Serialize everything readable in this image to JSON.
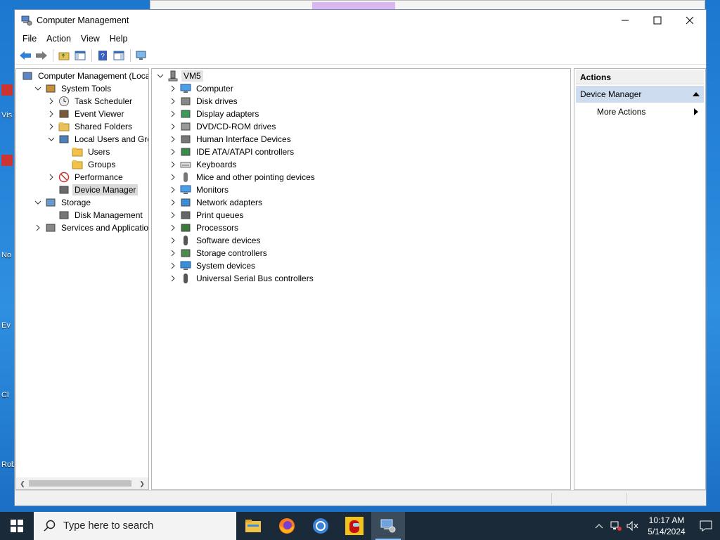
{
  "window": {
    "title": "Computer Management"
  },
  "menu": [
    "File",
    "Action",
    "View",
    "Help"
  ],
  "left_tree": [
    {
      "label": "Computer Management (Local",
      "level": 0,
      "expander": "none",
      "icon": "computer-management-icon"
    },
    {
      "label": "System Tools",
      "level": 1,
      "expander": "open",
      "icon": "system-tools-icon"
    },
    {
      "label": "Task Scheduler",
      "level": 2,
      "expander": "closed",
      "icon": "clock-icon"
    },
    {
      "label": "Event Viewer",
      "level": 2,
      "expander": "closed",
      "icon": "event-viewer-icon"
    },
    {
      "label": "Shared Folders",
      "level": 2,
      "expander": "closed",
      "icon": "shared-folder-icon"
    },
    {
      "label": "Local Users and Groups",
      "level": 2,
      "expander": "open",
      "icon": "users-icon"
    },
    {
      "label": "Users",
      "level": 3,
      "expander": "none",
      "icon": "folder-icon"
    },
    {
      "label": "Groups",
      "level": 3,
      "expander": "none",
      "icon": "folder-icon"
    },
    {
      "label": "Performance",
      "level": 2,
      "expander": "closed",
      "icon": "performance-icon"
    },
    {
      "label": "Device Manager",
      "level": 2,
      "expander": "none",
      "icon": "device-manager-icon",
      "selected": true
    },
    {
      "label": "Storage",
      "level": 1,
      "expander": "open",
      "icon": "storage-icon"
    },
    {
      "label": "Disk Management",
      "level": 2,
      "expander": "none",
      "icon": "disk-management-icon"
    },
    {
      "label": "Services and Applications",
      "level": 1,
      "expander": "closed",
      "icon": "services-icon"
    }
  ],
  "device_tree": {
    "root": "VM5",
    "items": [
      {
        "label": "Computer",
        "icon": "monitor-icon"
      },
      {
        "label": "Disk drives",
        "icon": "disk-drive-icon"
      },
      {
        "label": "Display adapters",
        "icon": "display-adapter-icon"
      },
      {
        "label": "DVD/CD-ROM drives",
        "icon": "dvd-icon"
      },
      {
        "label": "Human Interface Devices",
        "icon": "hid-icon"
      },
      {
        "label": "IDE ATA/ATAPI controllers",
        "icon": "ide-controller-icon"
      },
      {
        "label": "Keyboards",
        "icon": "keyboard-icon"
      },
      {
        "label": "Mice and other pointing devices",
        "icon": "mouse-icon"
      },
      {
        "label": "Monitors",
        "icon": "monitor-icon"
      },
      {
        "label": "Network adapters",
        "icon": "network-adapter-icon"
      },
      {
        "label": "Print queues",
        "icon": "printer-icon"
      },
      {
        "label": "Processors",
        "icon": "processor-icon"
      },
      {
        "label": "Software devices",
        "icon": "software-device-icon"
      },
      {
        "label": "Storage controllers",
        "icon": "storage-controller-icon"
      },
      {
        "label": "System devices",
        "icon": "system-device-icon"
      },
      {
        "label": "Universal Serial Bus controllers",
        "icon": "usb-icon"
      }
    ]
  },
  "actions": {
    "header": "Actions",
    "group": "Device Manager",
    "items": [
      "More Actions"
    ]
  },
  "desktop_labels": [
    "Vis",
    "No",
    "Ev",
    "Cl",
    "Rob"
  ],
  "taskbar": {
    "search_placeholder": "Type here to search",
    "time": "10:17 AM",
    "date": "5/14/2024"
  },
  "colors": {
    "selection": "#cddcef",
    "taskbar": "#1a2a38",
    "desktop": "#1c77cf"
  }
}
